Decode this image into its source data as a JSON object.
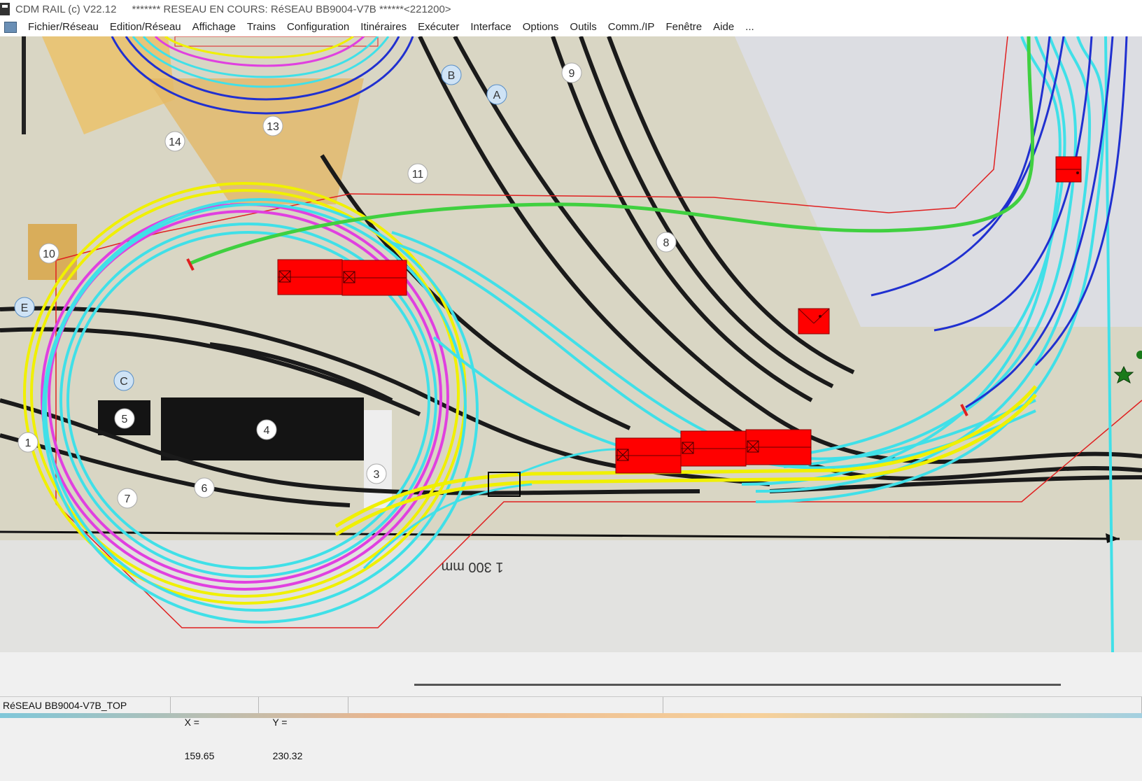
{
  "window": {
    "app_name": "CDM RAIL (c) V22.12",
    "title_status": "******* RESEAU EN COURS: RéSEAU BB9004-V7B ******<221200>"
  },
  "menu": {
    "items": [
      "Fichier/Réseau",
      "Edition/Réseau",
      "Affichage",
      "Trains",
      "Configuration",
      "Itinéraires",
      "Exécuter",
      "Interface",
      "Options",
      "Outils",
      "Comm./IP",
      "Fenêtre",
      "Aide",
      "..."
    ]
  },
  "layout_plan": {
    "labels": [
      "14",
      "13",
      "11",
      "9",
      "8",
      "10",
      "1",
      "3",
      "4",
      "5",
      "6",
      "7",
      "C",
      "E",
      "A",
      "B"
    ],
    "dimension_label": "1 300 mm",
    "colors": {
      "background": "#d9d6c4",
      "track_cyan": "#40e0e8",
      "track_yellow": "#f0f000",
      "track_magenta": "#e040e0",
      "track_blue": "#2030d0",
      "track_green": "#40d040",
      "train_red": "#ff0000",
      "boundary_red": "#e02020"
    }
  },
  "status": {
    "network_name": "RéSEAU BB9004-V7B_TOP",
    "x_label": "X =",
    "x_value": "159.65",
    "y_label": "Y =",
    "y_value": "230.32"
  }
}
